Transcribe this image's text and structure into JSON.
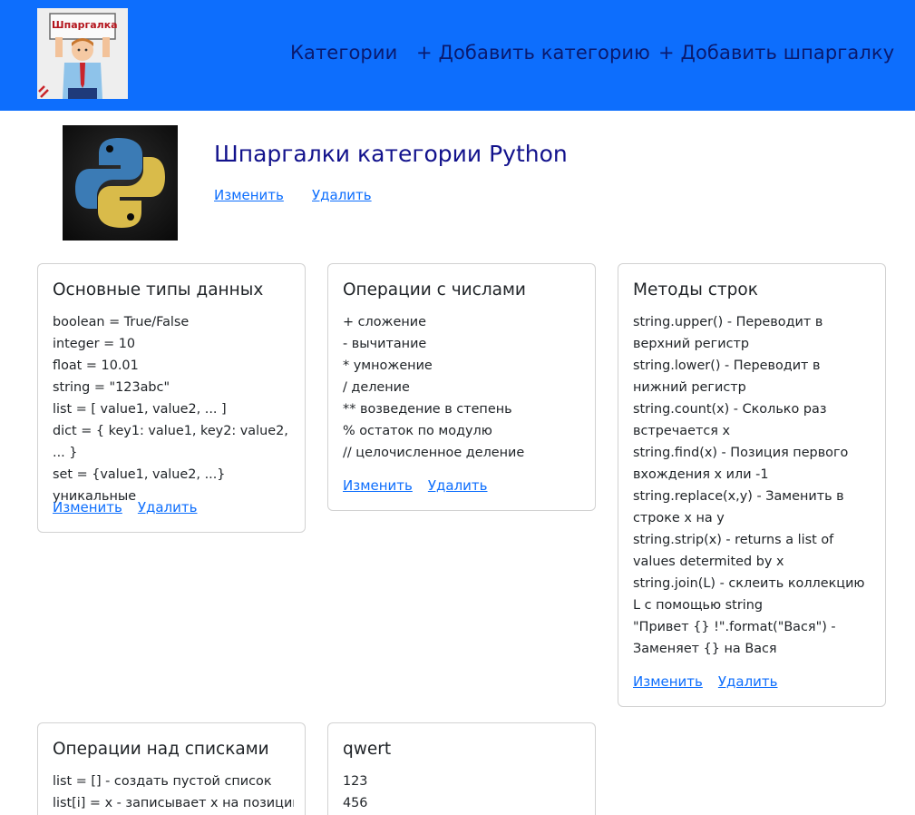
{
  "nav": {
    "logo_text": "Шпаргалка",
    "links": [
      "Категории",
      "+ Добавить категорию",
      "+ Добавить шпаргалку"
    ]
  },
  "category": {
    "title": "Шпаргалки категории Python",
    "edit": "Изменить",
    "delete": "Удалить"
  },
  "cards": [
    {
      "title": "Основные типы данных",
      "lines": [
        "boolean = True/False",
        "integer = 10",
        "float = 10.01",
        "string = \"123abc\"",
        "list = [ value1, value2, ... ]",
        "dict = { key1: value1, key2: value2, ... }",
        "set = {value1, value2, ...} уникальные"
      ],
      "edit": "Изменить",
      "delete": "Удалить"
    },
    {
      "title": "Операции с числами",
      "lines": [
        "+ сложение",
        "- вычитание",
        "* умножение",
        "/ деление",
        "** возведение в степень",
        "% остаток по модулю",
        "// целочисленное деление"
      ],
      "edit": "Изменить",
      "delete": "Удалить"
    },
    {
      "title": "Методы строк",
      "lines": [
        "string.upper() - Переводит в верхний регистр",
        "string.lower() - Переводит в нижний регистр",
        "string.count(x) - Сколько раз встречается x",
        "string.find(x) - Позиция первого вхождения x или -1",
        "string.replace(x,y) - Заменить в строке x на y",
        "string.strip(x) - returns a list of values determited by x",
        "string.join(L) - склеить коллекцию L с помощью string",
        "\"Привет {} !\".format(\"Вася\") - Заменяет {} на Вася"
      ],
      "edit": "Изменить",
      "delete": "Удалить"
    },
    {
      "title": "Операции над списками",
      "lines": [
        "list = [] - создать пустой список",
        "list[i] = x - записывает x на позиции"
      ]
    },
    {
      "title": "qwert",
      "lines": [
        "123",
        "456"
      ]
    }
  ]
}
